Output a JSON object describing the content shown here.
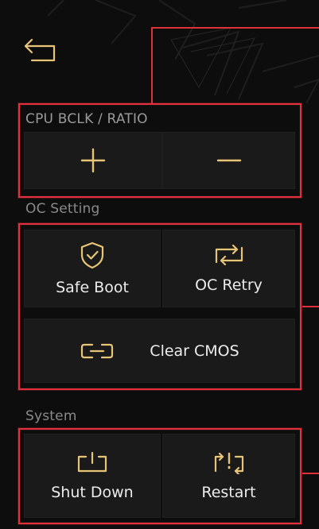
{
  "header": {
    "back_icon": "back-arrow-icon"
  },
  "sections": {
    "cpu": {
      "title": "CPU BCLK / RATIO",
      "buttons": [
        {
          "label": "",
          "icon": "plus-icon"
        },
        {
          "label": "",
          "icon": "minus-icon"
        }
      ]
    },
    "oc": {
      "title": "OC Setting",
      "buttons": [
        {
          "label": "Safe Boot",
          "icon": "shield-check-icon"
        },
        {
          "label": "OC Retry",
          "icon": "retry-arrows-icon"
        },
        {
          "label": "Clear CMOS",
          "icon": "link-icon"
        }
      ]
    },
    "system": {
      "title": "System",
      "buttons": [
        {
          "label": "Shut Down",
          "icon": "power-off-icon"
        },
        {
          "label": "Restart",
          "icon": "restart-icon"
        }
      ]
    }
  },
  "colors": {
    "accent_red": "#e5303c",
    "icon_gold": "#e8c476",
    "tile_bg": "#1a1a1a",
    "label_gray": "#8a8a8a"
  }
}
